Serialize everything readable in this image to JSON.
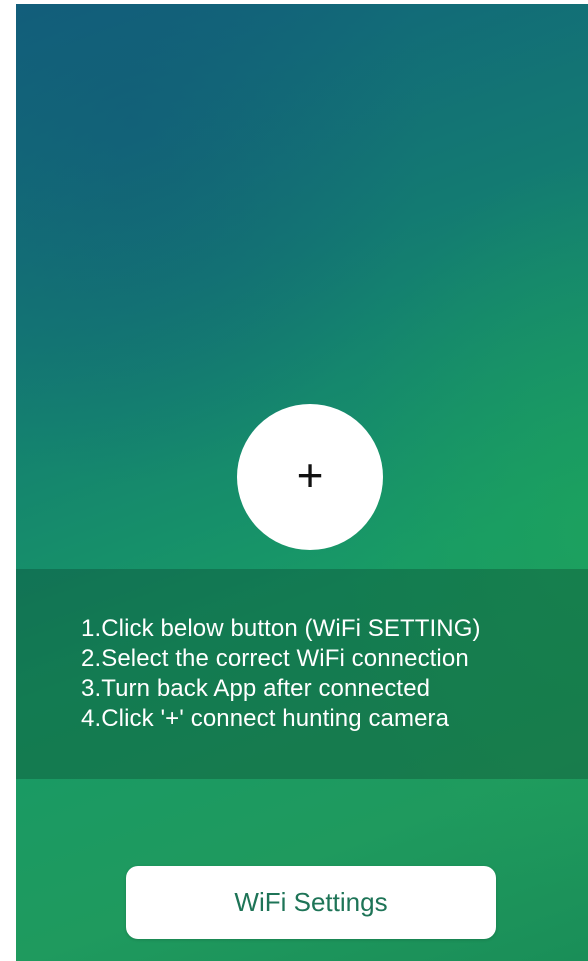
{
  "add_button": {
    "icon": "plus-icon",
    "glyph": "+"
  },
  "instructions": [
    "1.Click below button (WiFi SETTING)",
    "2.Select the correct WiFi connection",
    "3.Turn back App after connected",
    "4.Click '+' connect hunting camera"
  ],
  "wifi_button": {
    "label": "WiFi Settings"
  },
  "colors": {
    "background_top": "#12607c",
    "background_bottom": "#1f9a5e",
    "button_bg": "#ffffff",
    "button_text": "#1e7457",
    "instruction_text": "#ffffff"
  }
}
